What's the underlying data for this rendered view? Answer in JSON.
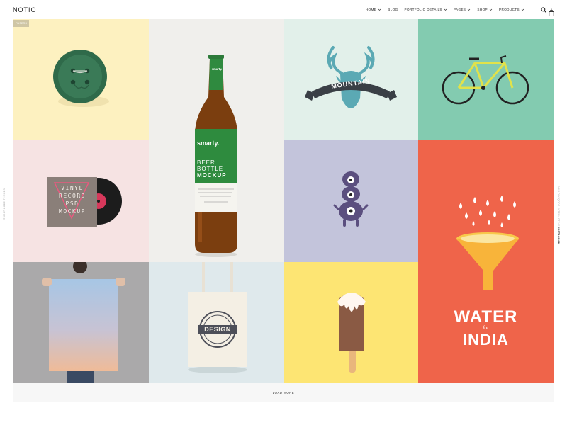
{
  "header": {
    "logo": "NOTIO",
    "nav": [
      {
        "label": "HOME",
        "has_dropdown": true
      },
      {
        "label": "BLOG",
        "has_dropdown": false
      },
      {
        "label": "PORTFOLIO DETAILS",
        "has_dropdown": true
      },
      {
        "label": "PAGES",
        "has_dropdown": true
      },
      {
        "label": "SHOP",
        "has_dropdown": true
      },
      {
        "label": "PRODUCTS",
        "has_dropdown": true
      }
    ],
    "search_icon": "search-icon",
    "cart_icon": "shopping-bag-icon",
    "cart_count": "0"
  },
  "grid": {
    "filter_tag": "FILTERS",
    "colors": {
      "yellow": "#fdf1c0",
      "lightgray": "#f0efec",
      "mint": "#e2f0ea",
      "teal": "#83cbb0",
      "pink": "#f6e3e3",
      "lavender": "#c3c4db",
      "coral": "#ef644a",
      "gray": "#aaa9aa",
      "ice": "#dfe9ec",
      "lemon": "#fde573"
    },
    "texts": {
      "beer_brand_top": "smarty.",
      "beer_brand": "smarty.",
      "beer_line1": "BEER",
      "beer_line2": "BOTTLE",
      "beer_line3": "MOCKUP",
      "mountain": "MOUNTAIN",
      "vinyl_line1": "VINYL",
      "vinyl_line2": "RECORD",
      "vinyl_line3": "PSD",
      "vinyl_line4": "MOCKUP",
      "water_line1": "WATER",
      "water_line2": "for",
      "water_line3": "INDIA",
      "design": "DESIGN"
    }
  },
  "side": {
    "left": "© 2017 QODE THEMES",
    "right_prefix": "FOLLOW QODE INTERACTIVE",
    "right_bold": "INSTAGRAM"
  },
  "load_more": "LOAD MORE"
}
